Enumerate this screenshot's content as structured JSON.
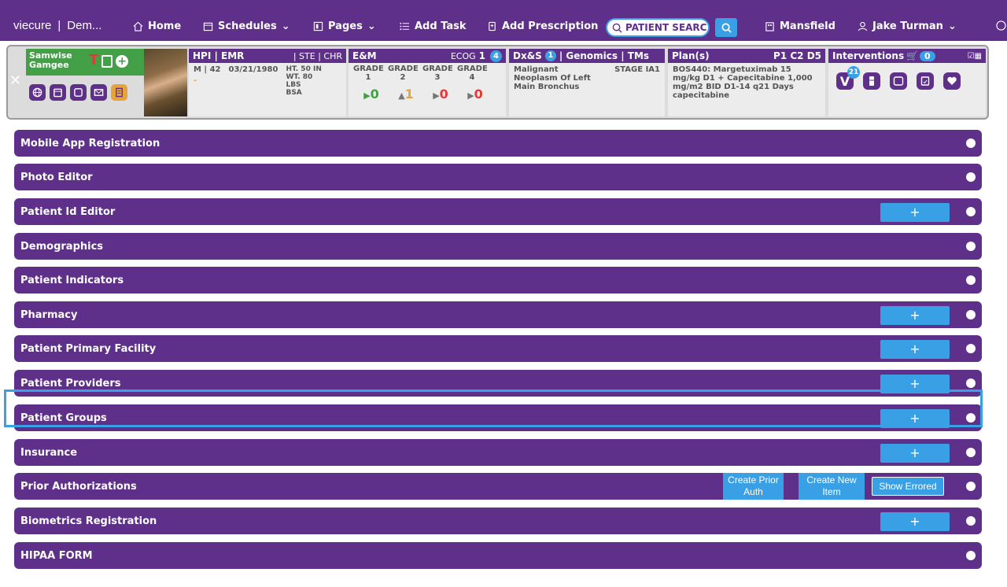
{
  "nav": {
    "brand": "viecure",
    "org": "Dem...",
    "home": "Home",
    "schedules": "Schedules",
    "pages": "Pages",
    "add_task": "Add Task",
    "add_prescription": "Add Prescription",
    "search_value": "PATIENT SEARC",
    "location": "Mansfield",
    "user": "Jake Turman"
  },
  "patient": {
    "first_name": "Samwise",
    "last_name": "Gamgee",
    "hpi_header": "HPI | EMR",
    "ste_chr": "| STE | CHR",
    "sex_age": "M | 42",
    "dob": "03/21/1980",
    "dash": "-",
    "ht": "HT. 50 IN",
    "wt": "WT. 80 LBS",
    "bsa": "BSA"
  },
  "em": {
    "header": "E&M",
    "ecog_label": "ECOG",
    "ecog_value": "1",
    "ecog_badge": "4",
    "grades": [
      "GRADE 1",
      "GRADE 2",
      "GRADE 3",
      "GRADE 4"
    ],
    "grade_values": [
      "0",
      "1",
      "0",
      "0"
    ]
  },
  "dx": {
    "header_prefix": "Dx&S",
    "badge": "1",
    "header_suffix": "| Genomics | TMs",
    "diagnosis": "Malignant Neoplasm Of Left Main Bronchus",
    "stage": "STAGE IA1"
  },
  "plan": {
    "header": "Plan(s)",
    "cycle": "P1 C2 D5",
    "text": "BOS440: Margetuximab 15 mg/kg D1 + Capecitabine 1,000 mg/m2 BID D1-14 q21 Days capecitabine"
  },
  "interventions": {
    "header": "Interventions",
    "cart_count": "0",
    "v_badge": "21"
  },
  "sections": [
    {
      "label": "Mobile App Registration"
    },
    {
      "label": "Photo Editor"
    },
    {
      "label": "Patient Id Editor",
      "plus": "+"
    },
    {
      "label": "Demographics"
    },
    {
      "label": "Patient Indicators"
    },
    {
      "label": "Pharmacy",
      "plus": "+"
    },
    {
      "label": "Patient Primary Facility",
      "plus": "+"
    },
    {
      "label": "Patient Providers",
      "plus": "+"
    },
    {
      "label": "Patient Groups",
      "plus": "+"
    },
    {
      "label": "Insurance",
      "plus": "+"
    },
    {
      "label": "Prior Authorizations",
      "create_prior_auth": "Create Prior Auth",
      "create_new_item": "Create New Item",
      "show_errored": "Show Errored"
    },
    {
      "label": "Biometrics Registration",
      "plus": "+"
    },
    {
      "label": "HIPAA FORM"
    }
  ],
  "colors": {
    "brand_purple": "#5e3089",
    "accent_blue": "#3aa0e6",
    "green": "#43a047",
    "red": "#e53935"
  }
}
